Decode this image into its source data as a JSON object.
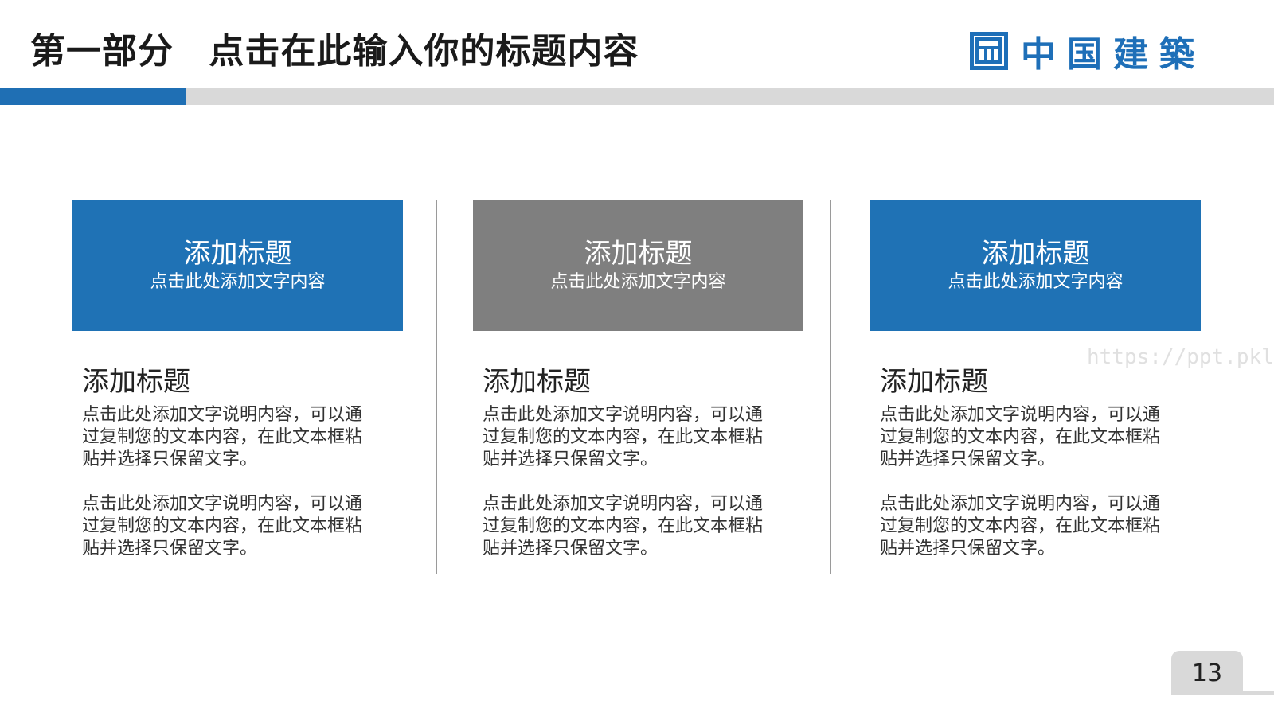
{
  "title": {
    "section": "第一部分",
    "text": "点击在此输入你的标题内容"
  },
  "logo": {
    "text": "中国建築",
    "mark_icon": "cscec-logo-icon",
    "color": "#1e6fb8"
  },
  "colors": {
    "accent_blue": "#1f72b5",
    "header_gray": "#7f7f7f",
    "bar_gray": "#d9d9d9"
  },
  "columns": [
    {
      "header_title": "添加标题",
      "header_subtitle": "点击此处添加文字内容",
      "body_title": "添加标题",
      "paragraphs": [
        "点击此处添加文字说明内容，可以通过复制您的文本内容，在此文本框粘贴并选择只保留文字。",
        "点击此处添加文字说明内容，可以通过复制您的文本内容，在此文本框粘贴并选择只保留文字。"
      ]
    },
    {
      "header_title": "添加标题",
      "header_subtitle": "点击此处添加文字内容",
      "body_title": "添加标题",
      "paragraphs": [
        "点击此处添加文字说明内容，可以通过复制您的文本内容，在此文本框粘贴并选择只保留文字。",
        "点击此处添加文字说明内容，可以通过复制您的文本内容，在此文本框粘贴并选择只保留文字。"
      ]
    },
    {
      "header_title": "添加标题",
      "header_subtitle": "点击此处添加文字内容",
      "body_title": "添加标题",
      "paragraphs": [
        "点击此处添加文字说明内容，可以通过复制您的文本内容，在此文本框粘贴并选择只保留文字。",
        "点击此处添加文字说明内容，可以通过复制您的文本内容，在此文本框粘贴并选择只保留文字。"
      ]
    }
  ],
  "watermark": "https://ppt.pkll.de",
  "page_number": "13"
}
